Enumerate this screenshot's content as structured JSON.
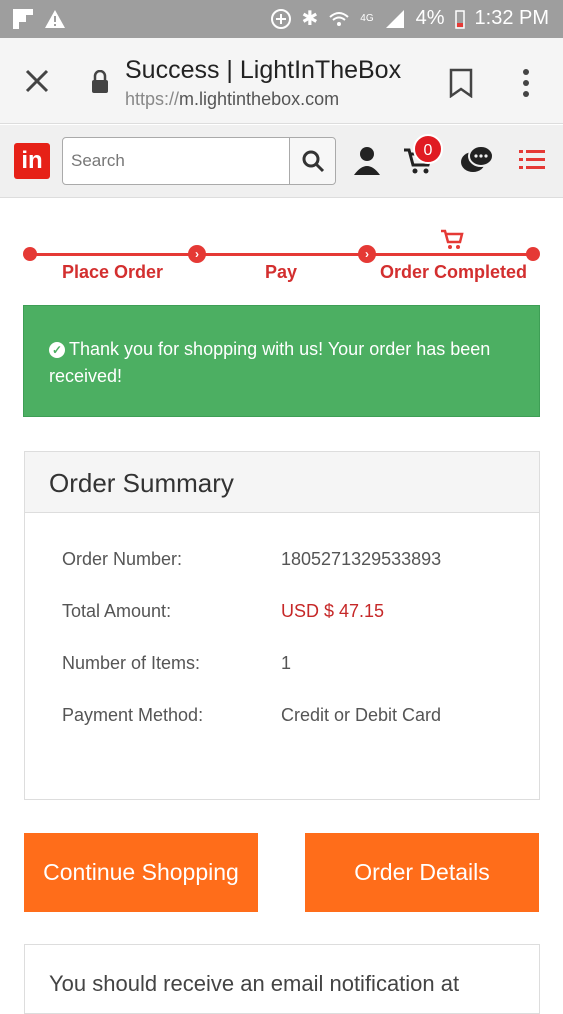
{
  "status_bar": {
    "battery": "4%",
    "time": "1:32 PM",
    "network": "4G"
  },
  "browser": {
    "page_title": "Success | LightInTheBox",
    "url_protocol": "https://",
    "url_host": "m.lightinthebox.com"
  },
  "header": {
    "logo": "in",
    "search_placeholder": "Search",
    "cart_count": "0"
  },
  "progress": {
    "steps": [
      "Place Order",
      "Pay",
      "Order Completed"
    ]
  },
  "alert": {
    "message": "Thank you for shopping with us! Your order has been received!"
  },
  "summary": {
    "title": "Order Summary",
    "rows": [
      {
        "label": "Order Number:",
        "value": "1805271329533893"
      },
      {
        "label": "Total Amount:",
        "value": "USD $ 47.15"
      },
      {
        "label": "Number of Items:",
        "value": "1"
      },
      {
        "label": "Payment Method:",
        "value": "Credit or Debit Card"
      }
    ]
  },
  "buttons": {
    "continue": "Continue Shopping",
    "details": "Order Details"
  },
  "notice": {
    "text": "You should receive an email notification at"
  },
  "colors": {
    "accent_red": "#e53935",
    "success_green": "#4caf62",
    "button_orange": "#ff6d1a",
    "status_bar": "#9e9e9e"
  }
}
